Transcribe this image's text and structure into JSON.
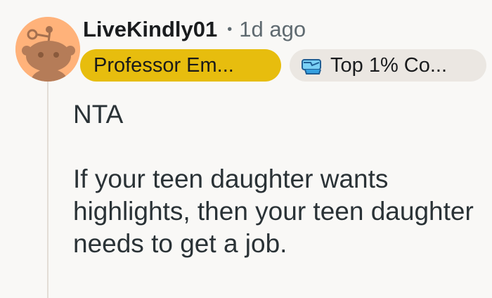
{
  "comment": {
    "username": "LiveKindly01",
    "separator": "•",
    "timestamp": "1d ago",
    "avatar_icon": "reddit-snoo-avatar-icon",
    "avatar_color": "#ffb27a",
    "user_flair": {
      "label": "Professor Em...",
      "background": "#e7bd0e"
    },
    "contributor_flair": {
      "icon": "top-contributor-icon",
      "label": "Top 1% Co..."
    },
    "body": [
      "NTA",
      "If your teen daughter wants highlights, then your teen daughter needs to get a job."
    ]
  }
}
